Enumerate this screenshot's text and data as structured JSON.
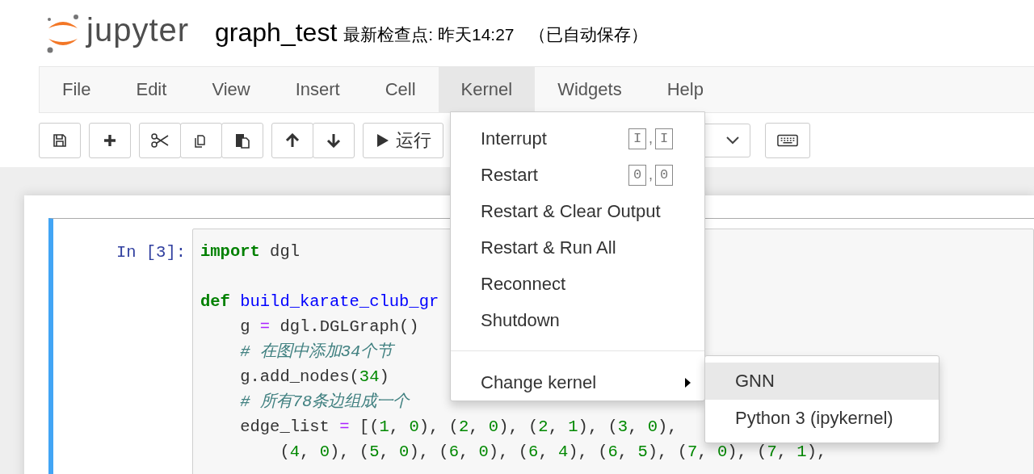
{
  "header": {
    "logo_text": "jupyter",
    "notebook_name": "graph_test",
    "checkpoint": "最新检查点: 昨天14:27",
    "autosave": "（已自动保存）"
  },
  "menubar": [
    {
      "label": "File",
      "selected": false
    },
    {
      "label": "Edit",
      "selected": false
    },
    {
      "label": "View",
      "selected": false
    },
    {
      "label": "Insert",
      "selected": false
    },
    {
      "label": "Cell",
      "selected": false
    },
    {
      "label": "Kernel",
      "selected": true
    },
    {
      "label": "Widgets",
      "selected": false
    },
    {
      "label": "Help",
      "selected": false
    }
  ],
  "toolbar": {
    "run_label": "运行"
  },
  "cell": {
    "prompt": "In [3]:",
    "lines": [
      {
        "kind": "top",
        "tokens": [
          {
            "kind": "kw",
            "text": "import"
          },
          {
            "kind": "plain",
            "text": " dgl"
          }
        ]
      },
      {
        "kind": "blank"
      },
      {
        "kind": "top",
        "tokens": [
          {
            "kind": "kw",
            "text": "def"
          },
          {
            "kind": "fn",
            "text": " build_karate_club_gr"
          }
        ]
      },
      {
        "kind": "body",
        "tokens": [
          {
            "kind": "plain",
            "text": "g "
          },
          {
            "kind": "op",
            "text": "="
          },
          {
            "kind": "plain",
            "text": " dgl.DGLGraph()"
          }
        ]
      },
      {
        "kind": "body",
        "tokens": [
          {
            "kind": "comment",
            "text": "# 在图中添加34个节"
          }
        ]
      },
      {
        "kind": "body",
        "tokens": [
          {
            "kind": "plain",
            "text": "g.add_nodes("
          },
          {
            "kind": "num",
            "text": "34"
          },
          {
            "kind": "plain",
            "text": ")"
          }
        ]
      },
      {
        "kind": "body",
        "tokens": [
          {
            "kind": "comment",
            "text": "# 所有78条边组成一个"
          }
        ]
      },
      {
        "kind": "body",
        "tokens": [
          {
            "kind": "plain",
            "text": "edge_list "
          },
          {
            "kind": "op",
            "text": "="
          },
          {
            "kind": "plain",
            "text": " [("
          },
          {
            "kind": "num",
            "text": "1"
          },
          {
            "kind": "plain",
            "text": ", "
          },
          {
            "kind": "num",
            "text": "0"
          },
          {
            "kind": "plain",
            "text": "), ("
          },
          {
            "kind": "num",
            "text": "2"
          },
          {
            "kind": "plain",
            "text": ", "
          },
          {
            "kind": "num",
            "text": "0"
          },
          {
            "kind": "plain",
            "text": "), ("
          },
          {
            "kind": "num",
            "text": "2"
          },
          {
            "kind": "plain",
            "text": ", "
          },
          {
            "kind": "num",
            "text": "1"
          },
          {
            "kind": "plain",
            "text": "), ("
          },
          {
            "kind": "num",
            "text": "3"
          },
          {
            "kind": "plain",
            "text": ", "
          },
          {
            "kind": "num",
            "text": "0"
          },
          {
            "kind": "plain",
            "text": "),"
          }
        ]
      },
      {
        "kind": "cont",
        "tokens": [
          {
            "kind": "plain",
            "text": "("
          },
          {
            "kind": "num",
            "text": "4"
          },
          {
            "kind": "plain",
            "text": ", "
          },
          {
            "kind": "num",
            "text": "0"
          },
          {
            "kind": "plain",
            "text": "), ("
          },
          {
            "kind": "num",
            "text": "5"
          },
          {
            "kind": "plain",
            "text": ", "
          },
          {
            "kind": "num",
            "text": "0"
          },
          {
            "kind": "plain",
            "text": "), ("
          },
          {
            "kind": "num",
            "text": "6"
          },
          {
            "kind": "plain",
            "text": ", "
          },
          {
            "kind": "num",
            "text": "0"
          },
          {
            "kind": "plain",
            "text": "), ("
          },
          {
            "kind": "num",
            "text": "6"
          },
          {
            "kind": "plain",
            "text": ", "
          },
          {
            "kind": "num",
            "text": "4"
          },
          {
            "kind": "plain",
            "text": "), ("
          },
          {
            "kind": "num",
            "text": "6"
          },
          {
            "kind": "plain",
            "text": ", "
          },
          {
            "kind": "num",
            "text": "5"
          },
          {
            "kind": "plain",
            "text": "), ("
          },
          {
            "kind": "num",
            "text": "7"
          },
          {
            "kind": "plain",
            "text": ", "
          },
          {
            "kind": "num",
            "text": "0"
          },
          {
            "kind": "plain",
            "text": "), ("
          },
          {
            "kind": "num",
            "text": "7"
          },
          {
            "kind": "plain",
            "text": ", "
          },
          {
            "kind": "num",
            "text": "1"
          },
          {
            "kind": "plain",
            "text": "),"
          }
        ]
      }
    ]
  },
  "kernel_menu": [
    {
      "kind": "command",
      "label": "Interrupt",
      "shortcut": {
        "keys": [
          "I",
          "I"
        ],
        "separator": ","
      }
    },
    {
      "kind": "command",
      "label": "Restart",
      "shortcut": {
        "keys": [
          "0",
          "0"
        ],
        "separator": ","
      }
    },
    {
      "kind": "command",
      "label": "Restart & Clear Output"
    },
    {
      "kind": "command",
      "label": "Restart & Run All"
    },
    {
      "kind": "command",
      "label": "Reconnect"
    },
    {
      "kind": "command",
      "label": "Shutdown"
    },
    {
      "kind": "divider"
    },
    {
      "kind": "submenu",
      "label": "Change kernel"
    }
  ],
  "kernel_submenu": [
    {
      "label": "GNN",
      "highlighted": true
    },
    {
      "label": "Python 3 (ipykernel)",
      "highlighted": false
    }
  ]
}
